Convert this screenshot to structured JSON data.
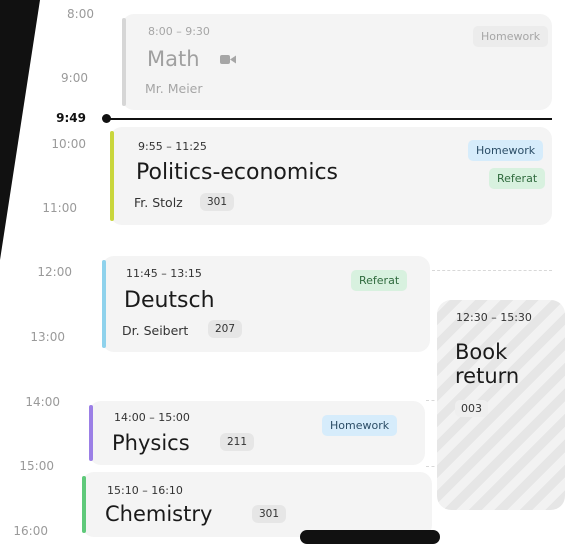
{
  "timeline": {
    "hours": [
      "8:00",
      "9:00",
      "10:00",
      "11:00",
      "12:00",
      "13:00",
      "14:00",
      "15:00",
      "16:00"
    ],
    "current_time": "9:49"
  },
  "events": {
    "math": {
      "time": "8:00 – 9:30",
      "title": "Math",
      "teacher": "Mr. Meier",
      "chip": "Homework",
      "color": "#d6d6d6"
    },
    "politics": {
      "time": "9:55 – 11:25",
      "title": "Politics-economics",
      "teacher": "Fr. Stolz",
      "room": "301",
      "chips": [
        "Homework",
        "Referat"
      ],
      "color": "#c9d63c"
    },
    "deutsch": {
      "time": "11:45 – 13:15",
      "title": "Deutsch",
      "teacher": "Dr. Seibert",
      "room": "207",
      "chip": "Referat",
      "color": "#8fd2ec"
    },
    "book": {
      "time": "12:30 – 15:30",
      "title_line1": "Book",
      "title_line2": "return",
      "room": "003"
    },
    "physics": {
      "time": "14:00 – 15:00",
      "title": "Physics",
      "room": "211",
      "chip": "Homework",
      "color": "#9b7fe6"
    },
    "chemistry": {
      "time": "15:10 – 16:10",
      "title": "Chemistry",
      "room": "301",
      "color": "#5fc97a"
    }
  },
  "icons": {
    "math_mode": "video-camera-icon"
  }
}
